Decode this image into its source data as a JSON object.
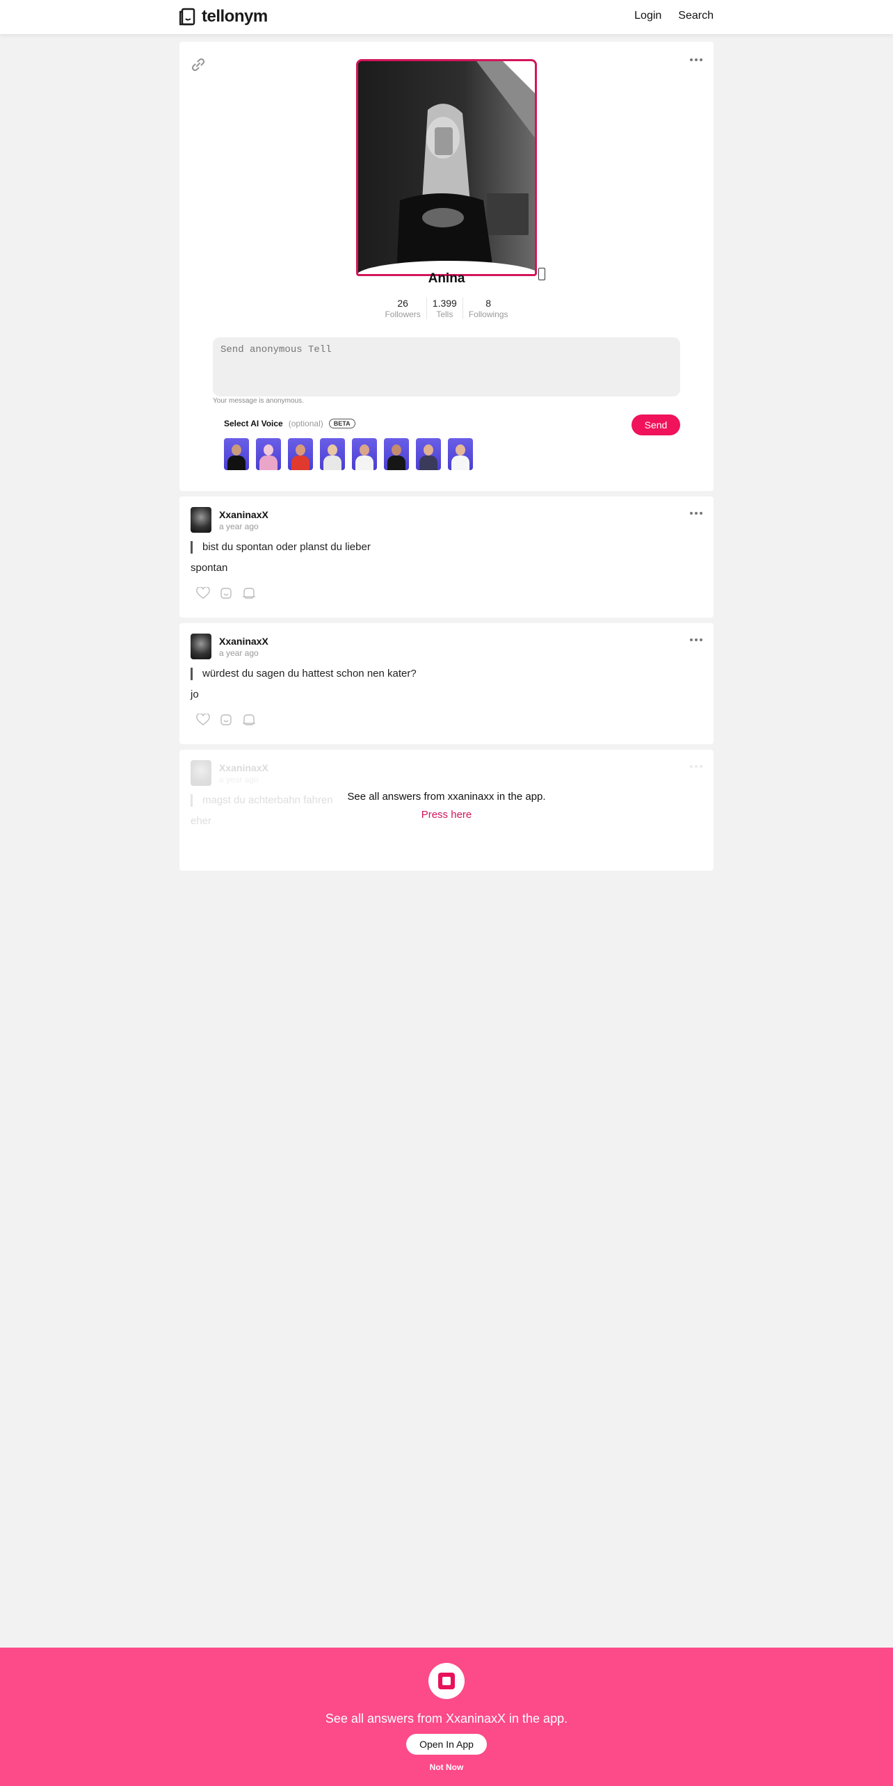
{
  "header": {
    "brand": "tellonym",
    "nav": {
      "login": "Login",
      "search": "Search"
    }
  },
  "profile": {
    "name": "Anina",
    "stats": [
      {
        "value": "26",
        "label": "Followers"
      },
      {
        "value": "1.399",
        "label": "Tells"
      },
      {
        "value": "8",
        "label": "Followings"
      }
    ],
    "tell_placeholder": "Send anonymous Tell",
    "anon_note": "Your message is anonymous.",
    "voice": {
      "title": "Select AI Voice",
      "optional": "(optional)",
      "badge": "BETA"
    },
    "send_label": "Send",
    "accent": "#d4145a"
  },
  "answers": [
    {
      "user": "XxaninaxX",
      "time": "a year ago",
      "question": "bist du spontan oder planst du lieber",
      "answer": "spontan"
    },
    {
      "user": "XxaninaxX",
      "time": "a year ago",
      "question": "würdest du sagen du hattest schon nen kater?",
      "answer": "jo"
    },
    {
      "user": "XxaninaxX",
      "time": "a year ago",
      "question": "magst du achterbahn fahren",
      "answer": "eher"
    }
  ],
  "gate": {
    "message": "See all answers from xxaninaxx in the app.",
    "link": "Press here"
  },
  "banner": {
    "text": "See all answers from XxaninaxX in the app.",
    "open_label": "Open In App",
    "not_now": "Not Now",
    "color": "#fd4a88"
  }
}
